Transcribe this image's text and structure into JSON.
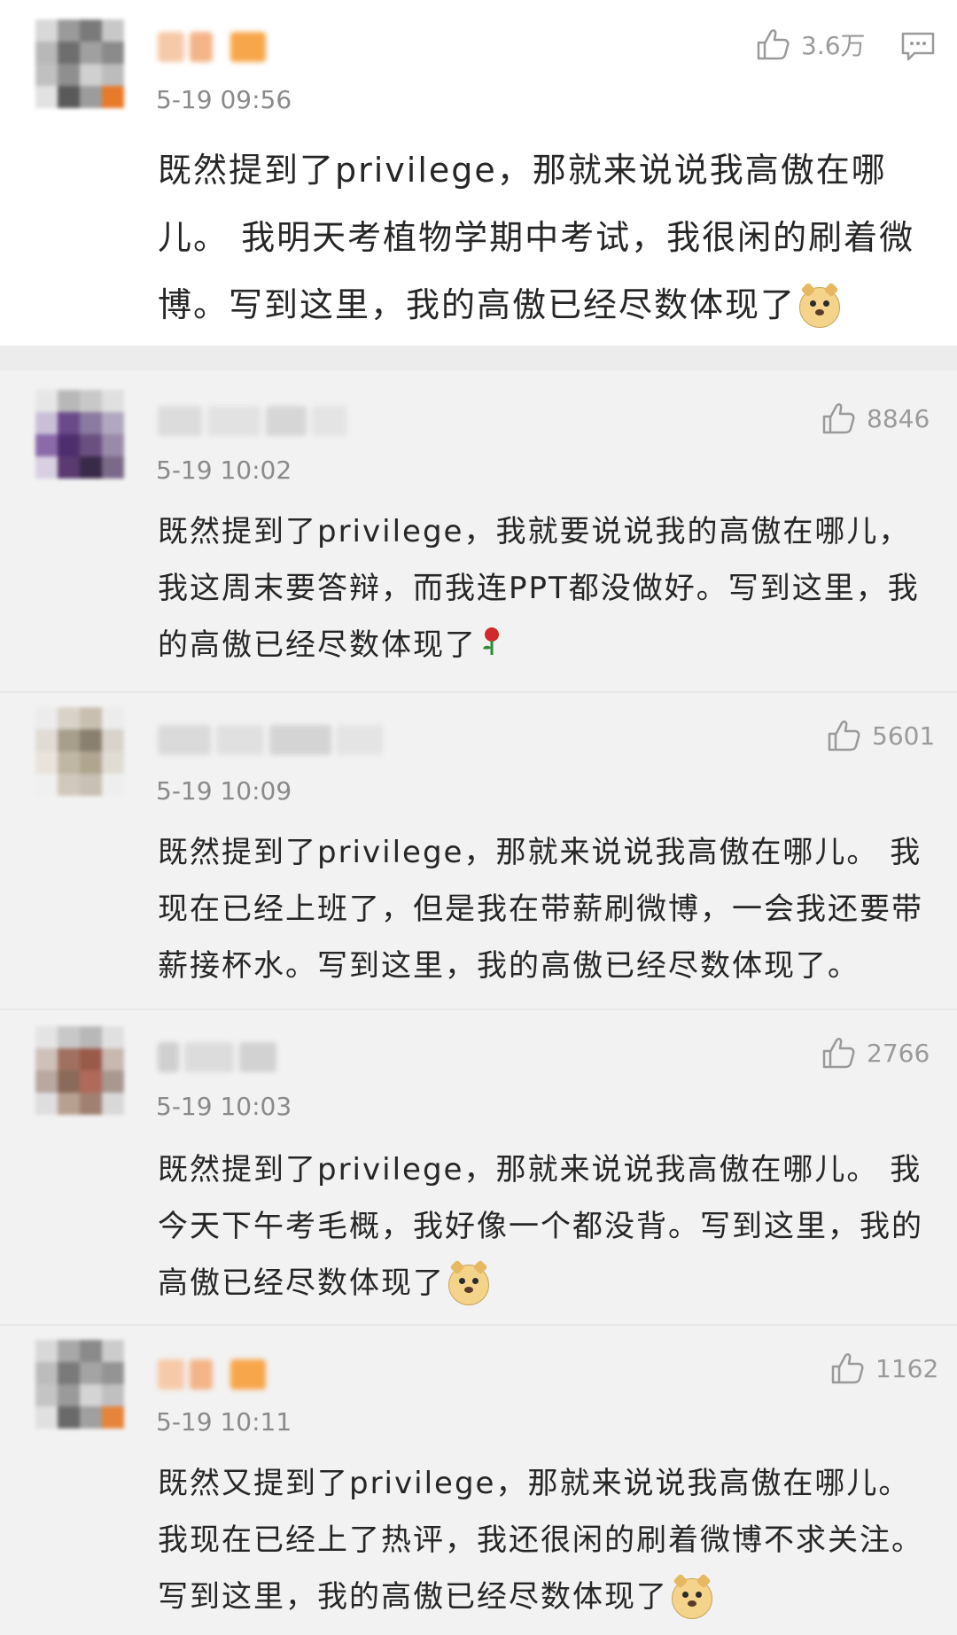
{
  "colors": {
    "hot_background": "#ffffff",
    "feed_background": "#f2f2f2",
    "text": "#262626",
    "meta_text": "#8a8a8a",
    "icon": "#9a9a9a"
  },
  "comments": [
    {
      "author": "",
      "time": "5-19 09:56",
      "likes": "3.6万",
      "text": "既然提到了privilege，那就来说说我高傲在哪儿。 我明天考植物学期中考试，我很闲的刷着微博。写到这里，我的高傲已经尽数体现了",
      "emoji": "doge-emoji"
    },
    {
      "author": "",
      "time": "5-19 10:02",
      "likes": "8846",
      "text": "既然提到了privilege，我就要说说我的高傲在哪儿，我这周末要答辩，而我连PPT都没做好。写到这里，我的高傲已经尽数体现了",
      "emoji": "rose-emoji"
    },
    {
      "author": "",
      "time": "5-19 10:09",
      "likes": "5601",
      "text": "既然提到了privilege，那就来说说我高傲在哪儿。 我现在已经上班了，但是我在带薪刷微博，一会我还要带薪接杯水。写到这里，我的高傲已经尽数体现了。",
      "emoji": ""
    },
    {
      "author": "",
      "time": "5-19 10:03",
      "likes": "2766",
      "text": "既然提到了privilege，那就来说说我高傲在哪儿。 我今天下午考毛概，我好像一个都没背。写到这里，我的高傲已经尽数体现了",
      "emoji": "doge-emoji"
    },
    {
      "author": "",
      "time": "5-19 10:11",
      "likes": "1162",
      "text": "既然又提到了privilege，那就来说说我高傲在哪儿。 我现在已经上了热评，我还很闲的刷着微博不求关注。写到这里，我的高傲已经尽数体现了",
      "emoji": "doge-emoji"
    }
  ]
}
